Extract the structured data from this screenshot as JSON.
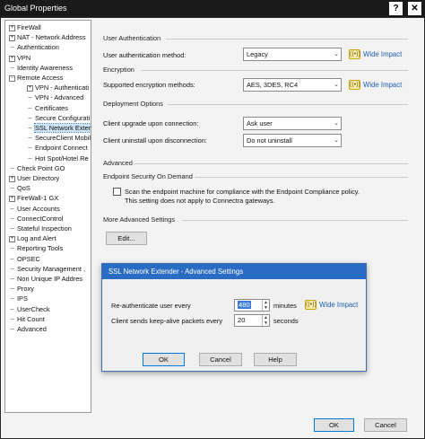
{
  "window": {
    "title": "Global Properties",
    "help": "?",
    "close": "✕"
  },
  "tree": [
    {
      "label": "FireWall",
      "indent": 0,
      "exp": "+"
    },
    {
      "label": "NAT - Network Address",
      "indent": 0,
      "exp": "+"
    },
    {
      "label": "Authentication",
      "indent": 0,
      "exp": ""
    },
    {
      "label": "VPN",
      "indent": 0,
      "exp": "+"
    },
    {
      "label": "Identity Awareness",
      "indent": 0,
      "exp": ""
    },
    {
      "label": "Remote Access",
      "indent": 0,
      "exp": "−"
    },
    {
      "label": "VPN - Authenticati",
      "indent": 1,
      "exp": "+"
    },
    {
      "label": "VPN - Advanced",
      "indent": 1,
      "exp": ""
    },
    {
      "label": "Certificates",
      "indent": 1,
      "exp": ""
    },
    {
      "label": "Secure Configurati",
      "indent": 1,
      "exp": ""
    },
    {
      "label": "SSL Network Exter",
      "indent": 1,
      "exp": "",
      "selected": true
    },
    {
      "label": "SecureClient Mobil",
      "indent": 1,
      "exp": ""
    },
    {
      "label": "Endpoint Connect",
      "indent": 1,
      "exp": ""
    },
    {
      "label": "Hot Spot/Hotel Re",
      "indent": 1,
      "exp": ""
    },
    {
      "label": "Check Point GO",
      "indent": 0,
      "exp": ""
    },
    {
      "label": "User Directory",
      "indent": 0,
      "exp": "+"
    },
    {
      "label": "QoS",
      "indent": 0,
      "exp": ""
    },
    {
      "label": "FireWall-1 GX",
      "indent": 0,
      "exp": "+"
    },
    {
      "label": "User Accounts",
      "indent": 0,
      "exp": ""
    },
    {
      "label": "ConnectControl",
      "indent": 0,
      "exp": ""
    },
    {
      "label": "Stateful Inspection",
      "indent": 0,
      "exp": ""
    },
    {
      "label": "Log and Alert",
      "indent": 0,
      "exp": "+"
    },
    {
      "label": "Reporting Tools",
      "indent": 0,
      "exp": ""
    },
    {
      "label": "OPSEC",
      "indent": 0,
      "exp": ""
    },
    {
      "label": "Security Management ,",
      "indent": 0,
      "exp": ""
    },
    {
      "label": "Non Unique IP Addres",
      "indent": 0,
      "exp": ""
    },
    {
      "label": "Proxy",
      "indent": 0,
      "exp": ""
    },
    {
      "label": "IPS",
      "indent": 0,
      "exp": ""
    },
    {
      "label": "UserCheck",
      "indent": 0,
      "exp": ""
    },
    {
      "label": "Hit Count",
      "indent": 0,
      "exp": ""
    },
    {
      "label": "Advanced",
      "indent": 0,
      "exp": ""
    }
  ],
  "user_auth": {
    "section": "User Authentication",
    "method_label": "User authentication method:",
    "method_value": "Legacy",
    "wide_impact": "Wide Impact"
  },
  "encryption": {
    "section": "Encryption",
    "methods_label": "Supported encryption methods:",
    "methods_value": "AES, 3DES, RC4",
    "wide_impact": "Wide Impact"
  },
  "deployment": {
    "section": "Deployment Options",
    "upgrade_label": "Client upgrade upon connection:",
    "upgrade_value": "Ask user",
    "uninstall_label": "Client uninstall upon disconnection:",
    "uninstall_value": "Do not uninstall"
  },
  "advanced": {
    "section": "Advanced",
    "endpoint_section": "Endpoint Security On Demand",
    "scan_line1": "Scan the endpoint machine for compliance with the Endpoint Compliance policy.",
    "scan_line2": "This setting does not apply to Connectra gateways.",
    "more_section": "More Advanced Settings",
    "edit_button": "Edit..."
  },
  "dialog": {
    "title": "SSL Network Extender - Advanced Settings",
    "reauth_label": "Re-authenticate user every",
    "reauth_value": "480",
    "reauth_unit": "minutes",
    "wide_impact": "Wide Impact",
    "keepalive_label": "Client sends keep-alive packets every",
    "keepalive_value": "20",
    "keepalive_unit": "seconds",
    "ok": "OK",
    "cancel": "Cancel",
    "help": "Help"
  },
  "footer": {
    "ok": "OK",
    "cancel": "Cancel"
  }
}
